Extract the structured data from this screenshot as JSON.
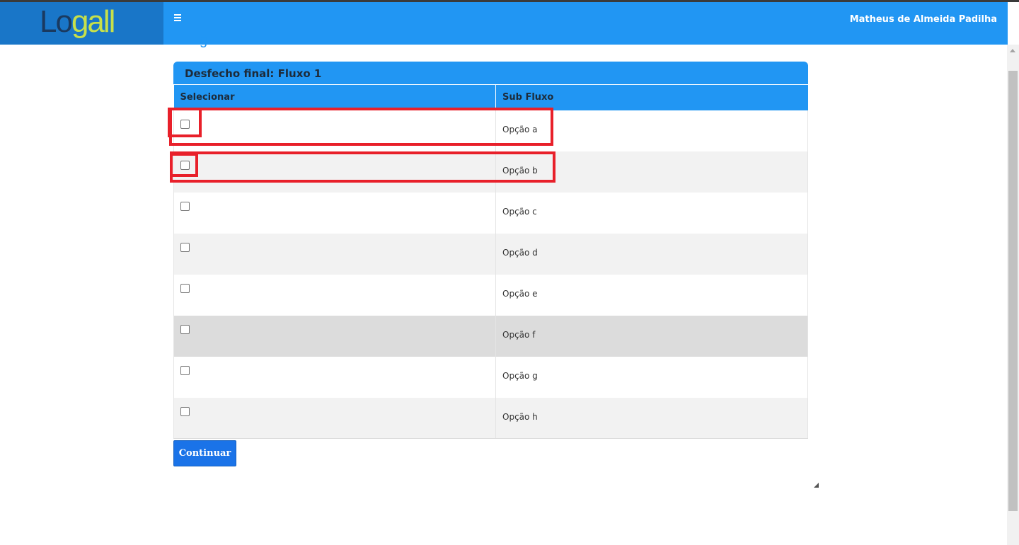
{
  "header": {
    "logo_lo": "Lo",
    "logo_gall": "gall",
    "user_name": "Matheus de Almeida Padilha"
  },
  "behind_text": "g",
  "panel": {
    "title": "Desfecho final: Fluxo 1",
    "columns": [
      "Selecionar",
      "Sub Fluxo"
    ],
    "rows": [
      {
        "label": "Opção a",
        "checked": false
      },
      {
        "label": "Opção b",
        "checked": false
      },
      {
        "label": "Opção c",
        "checked": false
      },
      {
        "label": "Opção d",
        "checked": false
      },
      {
        "label": "Opção e",
        "checked": false
      },
      {
        "label": "Opção f",
        "checked": false
      },
      {
        "label": "Opção g",
        "checked": false
      },
      {
        "label": "Opção h",
        "checked": false
      }
    ]
  },
  "continue_label": "Continuar",
  "colors": {
    "header_blue": "#2196f3",
    "logo_bg": "#1976c8",
    "button_blue": "#1a73e8",
    "highlight_red": "#e8202a"
  }
}
